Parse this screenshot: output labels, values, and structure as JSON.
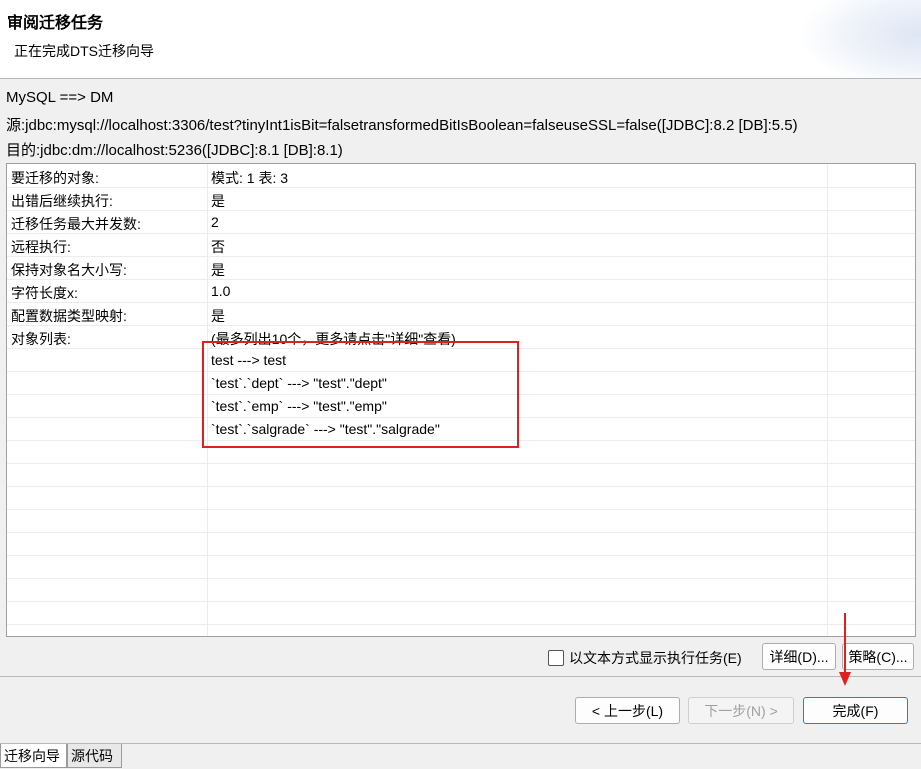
{
  "header": {
    "title": "审阅迁移任务",
    "subtitle": "正在完成DTS迁移向导"
  },
  "info": {
    "direction": "MySQL ==> DM",
    "source": "源:jdbc:mysql://localhost:3306/test?tinyInt1isBit=falsetransformedBitIsBoolean=falseuseSSL=false([JDBC]:8.2 [DB]:5.5)",
    "target": "目的:jdbc:dm://localhost:5236([JDBC]:8.1 [DB]:8.1)"
  },
  "summary": {
    "rows": [
      {
        "key": "要迁移的对象:",
        "value": "模式: 1 表: 3"
      },
      {
        "key": "出错后继续执行:",
        "value": "是"
      },
      {
        "key": "迁移任务最大并发数:",
        "value": "2"
      },
      {
        "key": "远程执行:",
        "value": "否"
      },
      {
        "key": "保持对象名大小写:",
        "value": "是"
      },
      {
        "key": "字符长度x:",
        "value": "1.0"
      },
      {
        "key": "配置数据类型映射:",
        "value": "是"
      },
      {
        "key": "对象列表:",
        "value": "(最多列出10个，更多请点击\"详细\"查看)"
      },
      {
        "key": "",
        "value": "test ---> test"
      },
      {
        "key": "",
        "value": "`test`.`dept` ---> \"test\".\"dept\""
      },
      {
        "key": "",
        "value": "`test`.`emp` ---> \"test\".\"emp\""
      },
      {
        "key": "",
        "value": "`test`.`salgrade` ---> \"test\".\"salgrade\""
      }
    ],
    "empty_rows": 8
  },
  "options": {
    "text_mode_label": "以文本方式显示执行任务(E)",
    "text_mode_checked": false,
    "detail_label": "详细(D)...",
    "strategy_label": "策略(C)..."
  },
  "nav": {
    "back_label": "< 上一步(L)",
    "next_label": "下一步(N) >",
    "finish_label": "完成(F)"
  },
  "tabs": [
    {
      "label": "迁移向导",
      "active": true
    },
    {
      "label": "源代码",
      "active": false
    }
  ],
  "colors": {
    "annotation": "#e02020",
    "primary_border": "#2f7ad6"
  }
}
